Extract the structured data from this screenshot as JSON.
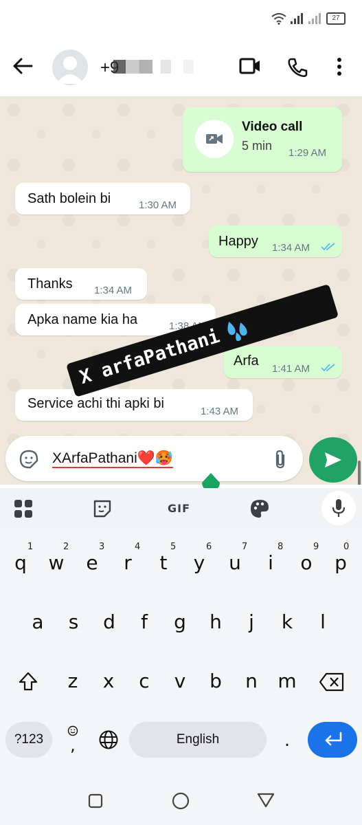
{
  "status_bar": {
    "battery": "27"
  },
  "header": {
    "contact": "+9"
  },
  "messages": [
    {
      "dir": "out",
      "type": "call",
      "title": "Video call",
      "duration": "5 min",
      "time": "1:29 AM"
    },
    {
      "dir": "in",
      "text": "Sath bolein bi",
      "time": "1:30 AM"
    },
    {
      "dir": "out",
      "text": "Happy",
      "time": "1:34 AM"
    },
    {
      "dir": "in",
      "text": "Thanks",
      "time": "1:34 AM"
    },
    {
      "dir": "in",
      "text": "Apka name kia ha",
      "time": "1:38 AM"
    },
    {
      "dir": "out",
      "text": "Arfa",
      "time": "1:41 AM"
    },
    {
      "dir": "in",
      "text": "Service achi thi apki bi",
      "time": "1:43 AM"
    }
  ],
  "overlay": {
    "text": "X arfaPathani"
  },
  "composer": {
    "text": "XArfaPathani❤️🥵"
  },
  "keyboard": {
    "toolbar": {
      "gif": "GIF"
    },
    "row1": [
      "q",
      "w",
      "e",
      "r",
      "t",
      "y",
      "u",
      "i",
      "o",
      "p"
    ],
    "row1_hints": [
      "1",
      "2",
      "3",
      "4",
      "5",
      "6",
      "7",
      "8",
      "9",
      "0"
    ],
    "row2": [
      "a",
      "s",
      "d",
      "f",
      "g",
      "h",
      "j",
      "k",
      "l"
    ],
    "row3": [
      "z",
      "x",
      "c",
      "v",
      "b",
      "n",
      "m"
    ],
    "symbols": "?123",
    "comma": ",",
    "period": ".",
    "space": "English"
  },
  "colors": {
    "accent": "#21a366",
    "outgoing": "#d9fdd3",
    "incoming": "#ffffff",
    "tick": "#53bdeb",
    "wallpaper": "#efe7dc"
  }
}
